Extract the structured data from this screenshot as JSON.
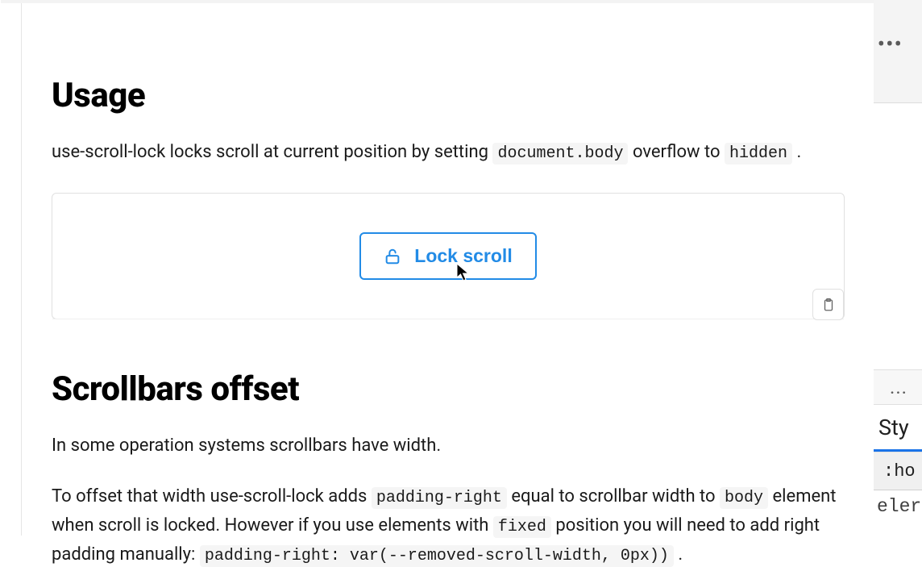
{
  "usage": {
    "heading": "Usage",
    "text_before_code1": "use-scroll-lock locks scroll at current position by setting ",
    "code1": "document.body",
    "text_between": " overflow to ",
    "code2": "hidden",
    "text_after": " ."
  },
  "demo": {
    "button_label": "Lock scroll"
  },
  "offset": {
    "heading": "Scrollbars offset",
    "p1": "In some operation systems scrollbars have width.",
    "p2_part1": "To offset that width use-scroll-lock adds ",
    "p2_code1": "padding-right",
    "p2_part2": " equal to scrollbar width to ",
    "p2_code2": "body",
    "p2_part3": " element when scroll is locked. However if you use elements with ",
    "p2_code3": "fixed",
    "p2_part4": " position you will need to add right padding manually: ",
    "p2_code4": "padding-right: var(--removed-scroll-width, 0px))",
    "p2_part5": " ."
  },
  "sidebar": {
    "more": "•••",
    "more2": "...",
    "tab": "Sty",
    "hover": ":ho",
    "elem": "eler"
  }
}
